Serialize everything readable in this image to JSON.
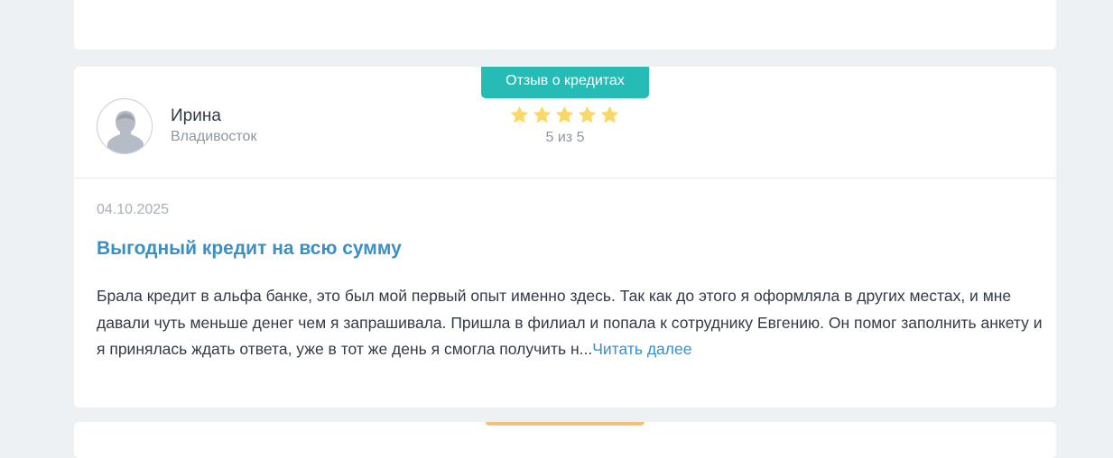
{
  "review": {
    "category_badge": "Отзыв о кредитах",
    "author": {
      "name": "Ирина",
      "city": "Владивосток",
      "avatar_icon": "user-silhouette-icon"
    },
    "rating": {
      "value": 5,
      "max": 5,
      "text": "5 из 5",
      "star_icon": "star-icon",
      "star_color": "#f9d867"
    },
    "date": "04.10.2025",
    "title": "Выгодный кредит на всю сумму",
    "body": "Брала кредит в альфа банке, это был мой первый опыт именно здесь. Так как до этого я оформляла в других местах, и мне давали чуть меньше денег чем я запрашивала. Пришла в филиал и попала к сотруднику Евгению. Он помог заполнить анкету и я принялась ждать ответа, уже в тот же день я смогла получить н...",
    "read_more": "Читать далее"
  },
  "colors": {
    "badge": "#26bbb4",
    "title": "#3a8fc4",
    "page_background": "#eef1f4",
    "next_badge": "#f3c27a"
  }
}
